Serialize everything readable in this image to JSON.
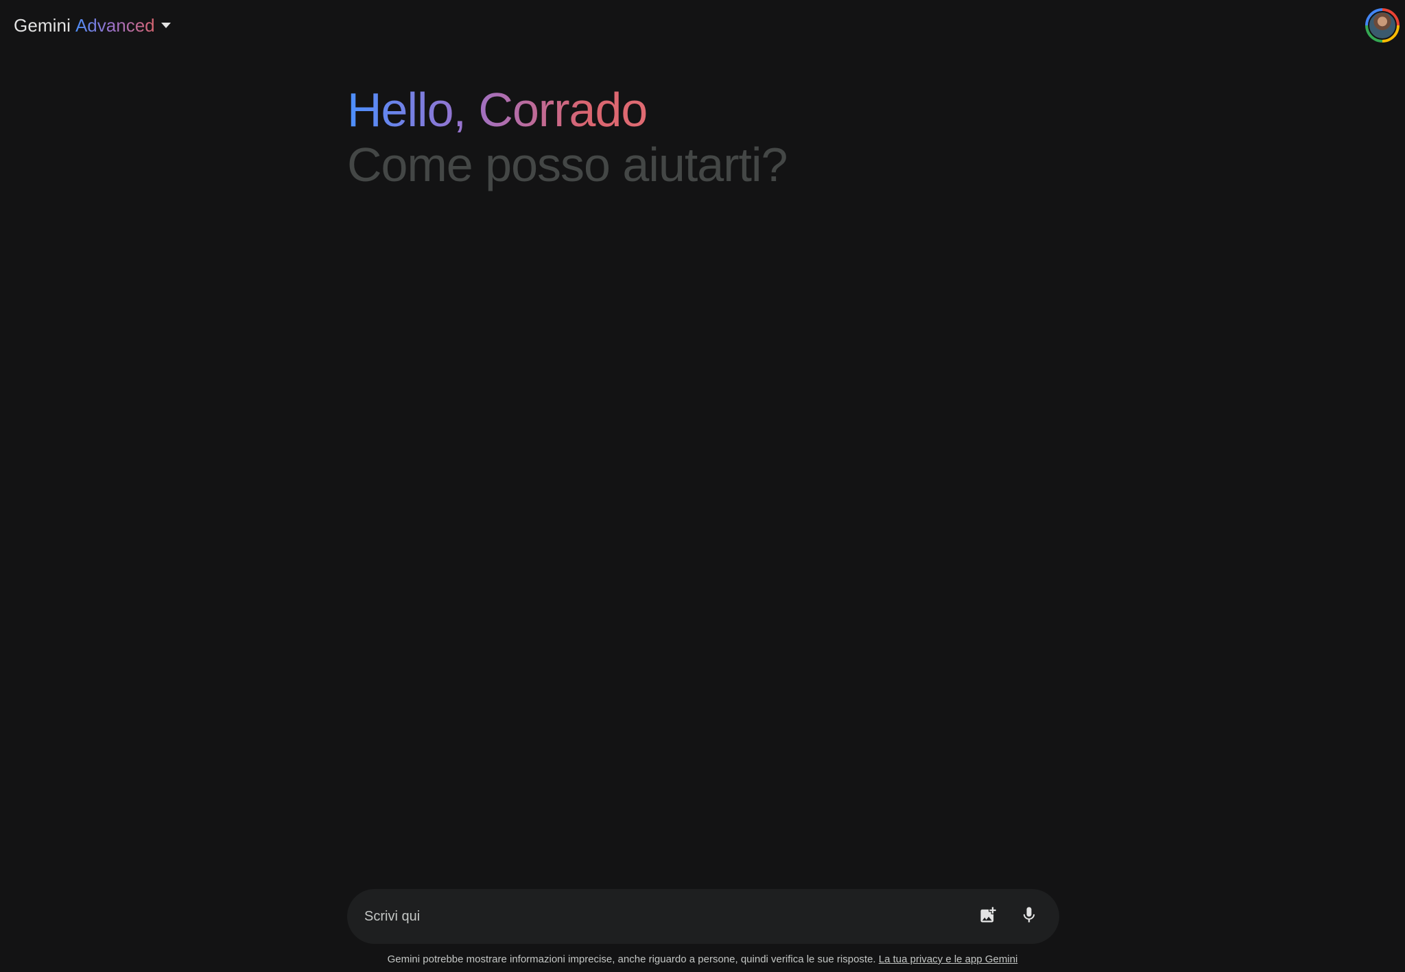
{
  "header": {
    "model_name": "Gemini",
    "model_tier": "Advanced",
    "dropdown_icon": "caret-down-icon",
    "avatar_icon": "user-avatar"
  },
  "greeting": {
    "hello": "Hello, Corrado",
    "subtitle": "Come posso aiutarti?"
  },
  "composer": {
    "placeholder": "Scrivi qui",
    "value": "",
    "image_button_icon": "add-image-icon",
    "mic_button_icon": "microphone-icon"
  },
  "footer": {
    "disclaimer": "Gemini potrebbe mostrare informazioni imprecise, anche riguardo a persone, quindi verifica le sue risposte.",
    "privacy_link": "La tua privacy e le app Gemini"
  },
  "colors": {
    "background": "#131314",
    "input_background": "#1e1f20",
    "gradient_blue": "#4b90ff",
    "gradient_purple": "#9b72cb",
    "gradient_red": "#d96570",
    "subtitle_gray": "#444746"
  }
}
